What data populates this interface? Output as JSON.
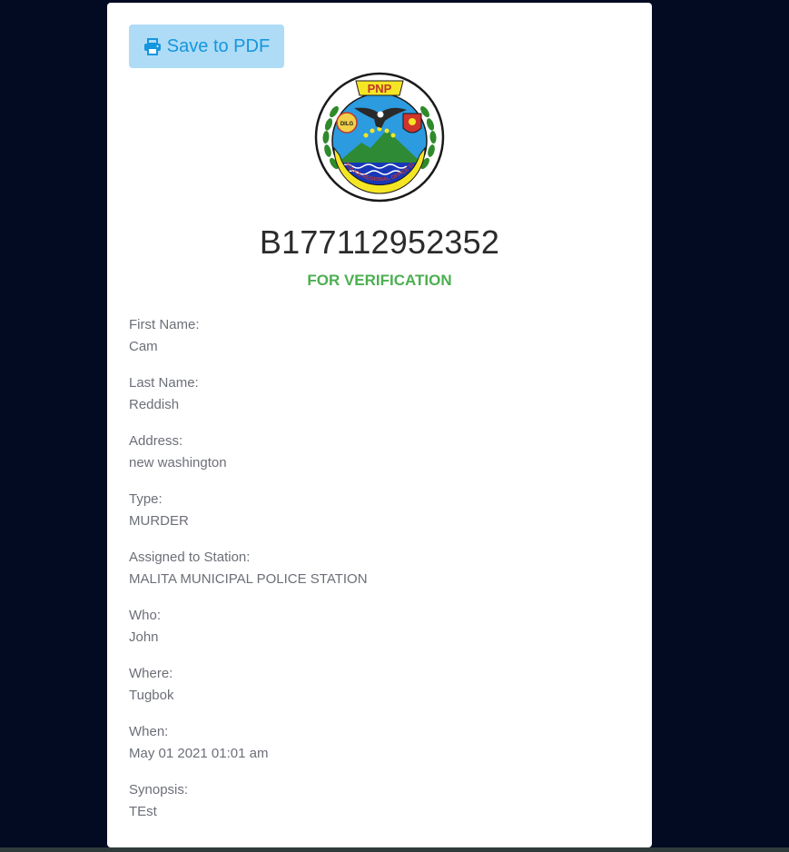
{
  "toolbar": {
    "save_pdf_label": "Save to PDF"
  },
  "logo": {
    "top_text": "PNP",
    "left_badge_text": "DILG",
    "ring_text": "POLICE REGIONAL OFFICE 11"
  },
  "record": {
    "case_number": "B177112952352",
    "status": "FOR VERIFICATION",
    "status_color": "#4caf50"
  },
  "fields": [
    {
      "label": "First Name:",
      "value": "Cam"
    },
    {
      "label": "Last Name:",
      "value": "Reddish"
    },
    {
      "label": "Address:",
      "value": "new washington"
    },
    {
      "label": "Type:",
      "value": "MURDER"
    },
    {
      "label": "Assigned to Station:",
      "value": "MALITA MUNICIPAL POLICE STATION"
    },
    {
      "label": "Who:",
      "value": "John"
    },
    {
      "label": "Where:",
      "value": "Tugbok"
    },
    {
      "label": "When:",
      "value": "May 01 2021 01:01 am"
    },
    {
      "label": "Synopsis:",
      "value": "TEst"
    }
  ],
  "colors": {
    "page_background": "#020b22",
    "card": "#ffffff",
    "button_background": "#aedcf6",
    "button_text": "#1596de"
  }
}
